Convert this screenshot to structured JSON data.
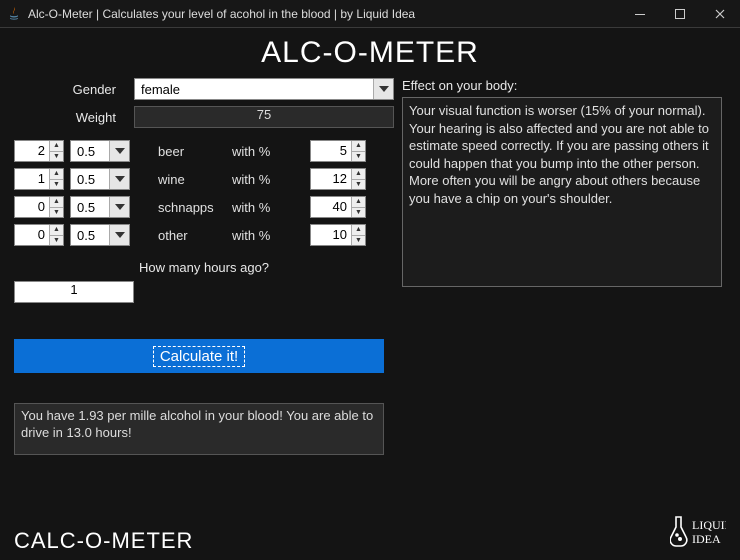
{
  "window": {
    "title": "Alc-O-Meter | Calculates your level of acohol in the blood | by Liquid Idea"
  },
  "heading": "ALC-O-METER",
  "form": {
    "gender_label": "Gender",
    "gender_value": "female",
    "weight_label": "Weight",
    "weight_value": "75",
    "drinks": [
      {
        "count": "2",
        "size": "0.5",
        "name": "beer",
        "pct_label": "with %",
        "pct": "5"
      },
      {
        "count": "1",
        "size": "0.5",
        "name": "wine",
        "pct_label": "with %",
        "pct": "12"
      },
      {
        "count": "0",
        "size": "0.5",
        "name": "schnapps",
        "pct_label": "with %",
        "pct": "40"
      },
      {
        "count": "0",
        "size": "0.5",
        "name": "other",
        "pct_label": "with %",
        "pct": "10"
      }
    ],
    "hours_label": "How many hours ago?",
    "hours_value": "1"
  },
  "calculate_label": "Calculate it!",
  "result_text": "You have 1.93  per mille alcohol in your blood! You are able to drive in 13.0 hours!",
  "effect": {
    "label": "Effect on your body:",
    "text": "Your visual function is worser (15% of your normal). Your hearing is also affected and you are not able to estimate speed correctly. If you are passing others it could happen that you bump into the other person. More often you will be angry about others because you  have a chip on your's shoulder."
  },
  "footer": {
    "left": "CALC-O-METER",
    "brand_top": "LIQUID",
    "brand_bottom": "IDEA"
  },
  "colors": {
    "accent": "#0b6fd6",
    "bg": "#141414"
  }
}
